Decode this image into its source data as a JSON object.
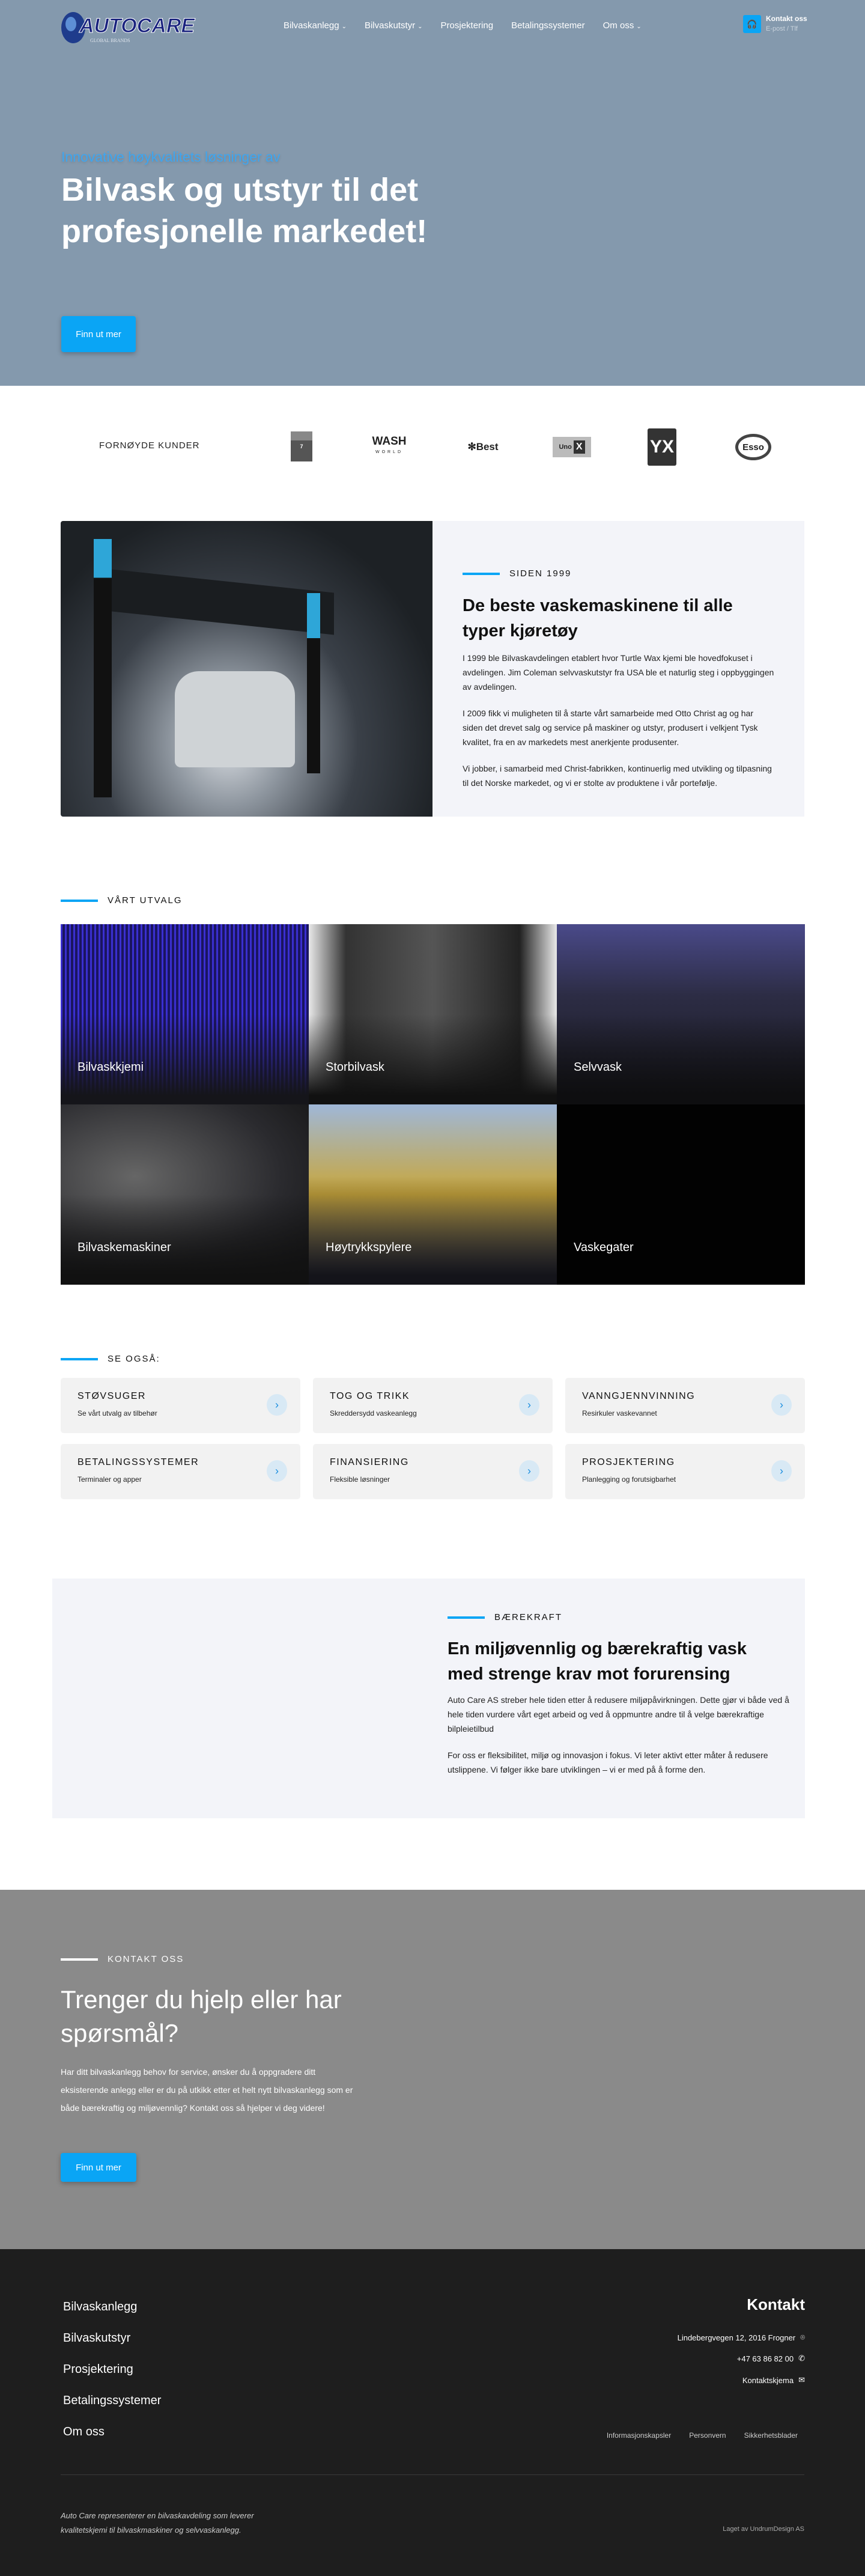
{
  "header": {
    "logo_text": "AUTOCARE",
    "logo_sub": "GLOBAL BRANDS",
    "nav": [
      {
        "label": "Bilvaskanlegg",
        "dropdown": true
      },
      {
        "label": "Bilvaskutstyr",
        "dropdown": true
      },
      {
        "label": "Prosjektering",
        "dropdown": false
      },
      {
        "label": "Betalingssystemer",
        "dropdown": false
      },
      {
        "label": "Om oss",
        "dropdown": true
      }
    ],
    "contact": {
      "title": "Kontakt oss",
      "subtitle": "E-post / Tlf",
      "icon": "headset-icon"
    }
  },
  "hero": {
    "subtitle": "Innovative høykvalitets løsninger av",
    "title": "Bilvask og utstyr til det profesjonelle markedet!",
    "button": "Finn ut mer"
  },
  "customers": {
    "label": "FORNØYDE KUNDER",
    "logos": [
      "7-ELEVEN",
      "WASH WORLD",
      "Best",
      "Uno-X",
      "YX",
      "Esso"
    ]
  },
  "about": {
    "label": "SIDEN 1999",
    "title": "De beste vaskemaskinene til alle typer kjøretøy",
    "paragraphs": [
      "I 1999 ble Bilvaskavdelingen etablert hvor Turtle Wax kjemi ble hovedfokuset i avdelingen. Jim Coleman selvvaskutstyr fra USA ble et naturlig steg i oppbyggingen av avdelingen.",
      "I 2009 fikk vi muligheten til å starte vårt samarbeide med Otto Christ ag og har siden det drevet salg og service på maskiner og utstyr, produsert i velkjent Tysk kvalitet, fra en av markedets mest anerkjente produsenter.",
      "Vi jobber, i samarbeid med Christ-fabrikken, kontinuerlig med utvikling og tilpasning til det Norske markedet, og vi er stolte av produktene i vår portefølje."
    ]
  },
  "range": {
    "label": "VÅRT UTVALG",
    "tiles": [
      "Bilvaskkjemi",
      "Storbilvask",
      "Selvvask",
      "Bilvaskemaskiner",
      "Høytrykkspylere",
      "Vaskegater"
    ]
  },
  "see_also": {
    "label": "SE OGSÅ:",
    "cards": [
      {
        "title": "STØVSUGER",
        "sub": "Se vårt utvalg av tilbehør"
      },
      {
        "title": "TOG OG TRIKK",
        "sub": "Skreddersydd vaskeanlegg"
      },
      {
        "title": "VANNGJENNVINNING",
        "sub": "Resirkuler vaskevannet"
      },
      {
        "title": "BETALINGSSYSTEMER",
        "sub": "Terminaler og apper"
      },
      {
        "title": "FINANSIERING",
        "sub": "Fleksible løsninger"
      },
      {
        "title": "PROSJEKTERING",
        "sub": "Planlegging og forutsigbarhet"
      }
    ]
  },
  "sustainability": {
    "label": "BÆREKRAFT",
    "title": "En miljøvennlig og bærekraftig vask med strenge krav mot forurensing",
    "paragraphs": [
      "Auto Care AS streber hele tiden etter å redusere miljøpåvirkningen. Dette gjør vi både ved å hele tiden vurdere vårt eget arbeid og ved å oppmuntre andre til å velge bærekraftige bilpleietilbud",
      "For oss er fleksibilitet, miljø og innovasjon i fokus. Vi leter aktivt etter måter å redusere utslippene. Vi følger ikke bare utviklingen – vi er med på å forme den."
    ]
  },
  "contact_section": {
    "label": "KONTAKT OSS",
    "title": "Trenger du hjelp eller har spørsmål?",
    "text": "Har ditt bilvaskanlegg behov for service, ønsker du å oppgradere ditt eksisterende anlegg eller er du på utkikk etter et helt nytt bilvaskanlegg som er både bærekraftig og miljøvennlig? Kontakt oss så hjelper vi deg videre!",
    "button": "Finn ut mer"
  },
  "footer": {
    "nav": [
      "Bilvaskanlegg",
      "Bilvaskutstyr",
      "Prosjektering",
      "Betalingssystemer",
      "Om oss"
    ],
    "contact_title": "Kontakt",
    "address": "Lindebergvegen 12, 2016 Frogner",
    "phone": "+47 63 86 82 00",
    "form": "Kontaktskjema",
    "links": [
      "Informasjonskapsler",
      "Personvern",
      "Sikkerhetsblader"
    ],
    "tagline": "Auto Care representerer en bilvaskavdeling som leverer kvalitetskjemi til bilvaskmaskiner og selvvaskanlegg.",
    "credit": "Laget av UndrumDesign AS"
  },
  "colors": {
    "accent": "#0aa5f5",
    "hero_bg": "#8499ad",
    "contact_bg": "#8a8a8a",
    "footer_bg": "#1e1e1e",
    "panel_bg": "#f3f4f9"
  }
}
